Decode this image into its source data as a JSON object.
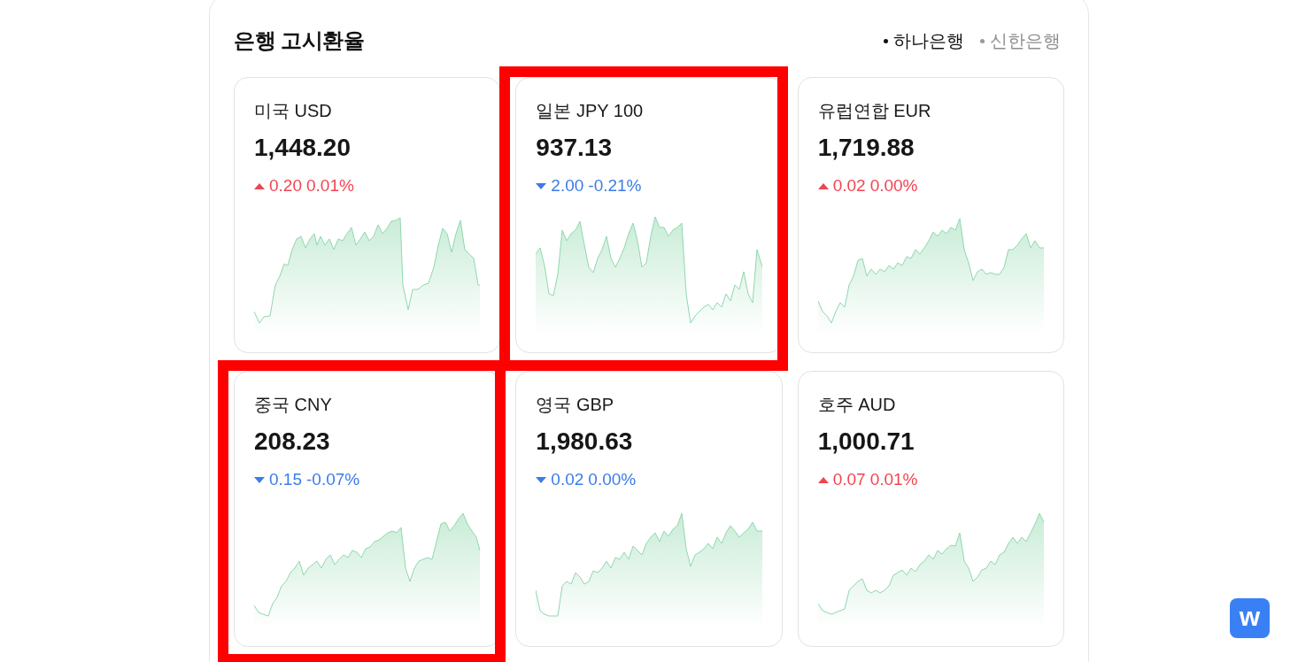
{
  "title": "은행 고시환율",
  "banks": [
    {
      "label": "하나은행",
      "selected": true
    },
    {
      "label": "신한은행",
      "selected": false
    }
  ],
  "cards": [
    {
      "currency": "미국 USD",
      "rate": "1,448.20",
      "rising": true,
      "change": "0.20",
      "percent": "0.01%",
      "highlighted": false
    },
    {
      "currency": "일본 JPY 100",
      "rate": "937.13",
      "rising": false,
      "change": "2.00",
      "percent": "-0.21%",
      "highlighted": true
    },
    {
      "currency": "유럽연합 EUR",
      "rate": "1,719.88",
      "rising": true,
      "change": "0.02",
      "percent": "0.00%",
      "highlighted": false
    },
    {
      "currency": "중국 CNY",
      "rate": "208.23",
      "rising": false,
      "change": "0.15",
      "percent": "-0.07%",
      "highlighted": true
    },
    {
      "currency": "영국 GBP",
      "rate": "1,980.63",
      "rising": false,
      "change": "0.02",
      "percent": "0.00%",
      "highlighted": false
    },
    {
      "currency": "호주 AUD",
      "rate": "1,000.71",
      "rising": true,
      "change": "0.07",
      "percent": "0.01%",
      "highlighted": false
    }
  ],
  "floating_button": {
    "label": "w"
  }
}
